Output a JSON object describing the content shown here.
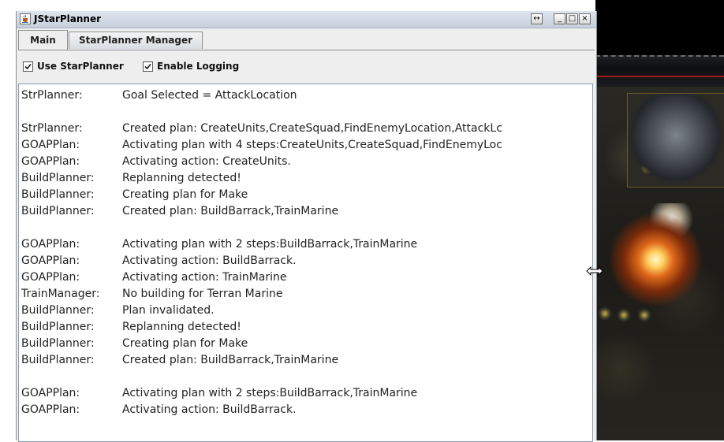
{
  "window": {
    "title": "JStarPlanner",
    "controls": {
      "resize": "↔",
      "minimize": "_",
      "maximize": "□",
      "close": "×"
    }
  },
  "tabs": [
    {
      "label": "Main",
      "selected": true
    },
    {
      "label": "StarPlanner Manager",
      "selected": false
    }
  ],
  "options": [
    {
      "label": "Use StarPlanner",
      "checked": true
    },
    {
      "label": "Enable Logging",
      "checked": true
    }
  ],
  "log": [
    {
      "source": "StrPlanner:",
      "message": "Goal Selected = AttackLocation"
    },
    {
      "source": "",
      "message": ""
    },
    {
      "source": "StrPlanner:",
      "message": "Created plan: CreateUnits,CreateSquad,FindEnemyLocation,AttackLc"
    },
    {
      "source": "GOAPPlan:",
      "message": "Activating plan with 4 steps:CreateUnits,CreateSquad,FindEnemyLoc"
    },
    {
      "source": "GOAPPlan:",
      "message": "Activating action: CreateUnits."
    },
    {
      "source": "BuildPlanner:",
      "message": "Replanning detected!"
    },
    {
      "source": "BuildPlanner:",
      "message": "Creating plan for Make"
    },
    {
      "source": "BuildPlanner:",
      "message": "Created plan: BuildBarrack,TrainMarine"
    },
    {
      "source": "",
      "message": ""
    },
    {
      "source": "GOAPPlan:",
      "message": "Activating plan with 2 steps:BuildBarrack,TrainMarine"
    },
    {
      "source": "GOAPPlan:",
      "message": "Activating action: BuildBarrack."
    },
    {
      "source": "GOAPPlan:",
      "message": "Activating action: TrainMarine"
    },
    {
      "source": "TrainManager:",
      "message": "No building for Terran Marine"
    },
    {
      "source": "BuildPlanner:",
      "message": "Plan invalidated."
    },
    {
      "source": "BuildPlanner:",
      "message": "Replanning detected!"
    },
    {
      "source": "BuildPlanner:",
      "message": "Creating plan for Make"
    },
    {
      "source": "BuildPlanner:",
      "message": "Created plan: BuildBarrack,TrainMarine"
    },
    {
      "source": "",
      "message": ""
    },
    {
      "source": "GOAPPlan:",
      "message": "Activating plan with 2 steps:BuildBarrack,TrainMarine"
    },
    {
      "source": "GOAPPlan:",
      "message": "Activating action: BuildBarrack."
    }
  ],
  "icons": {
    "app": "java-cup-icon",
    "resize": "horizontal-resize-icon",
    "cursor": "resize-cursor-icon",
    "checkbox": "checkmark-icon"
  },
  "colors": {
    "titlebar": "#c7cfdc",
    "log_border": "#7f9db9",
    "text": "#222222"
  }
}
